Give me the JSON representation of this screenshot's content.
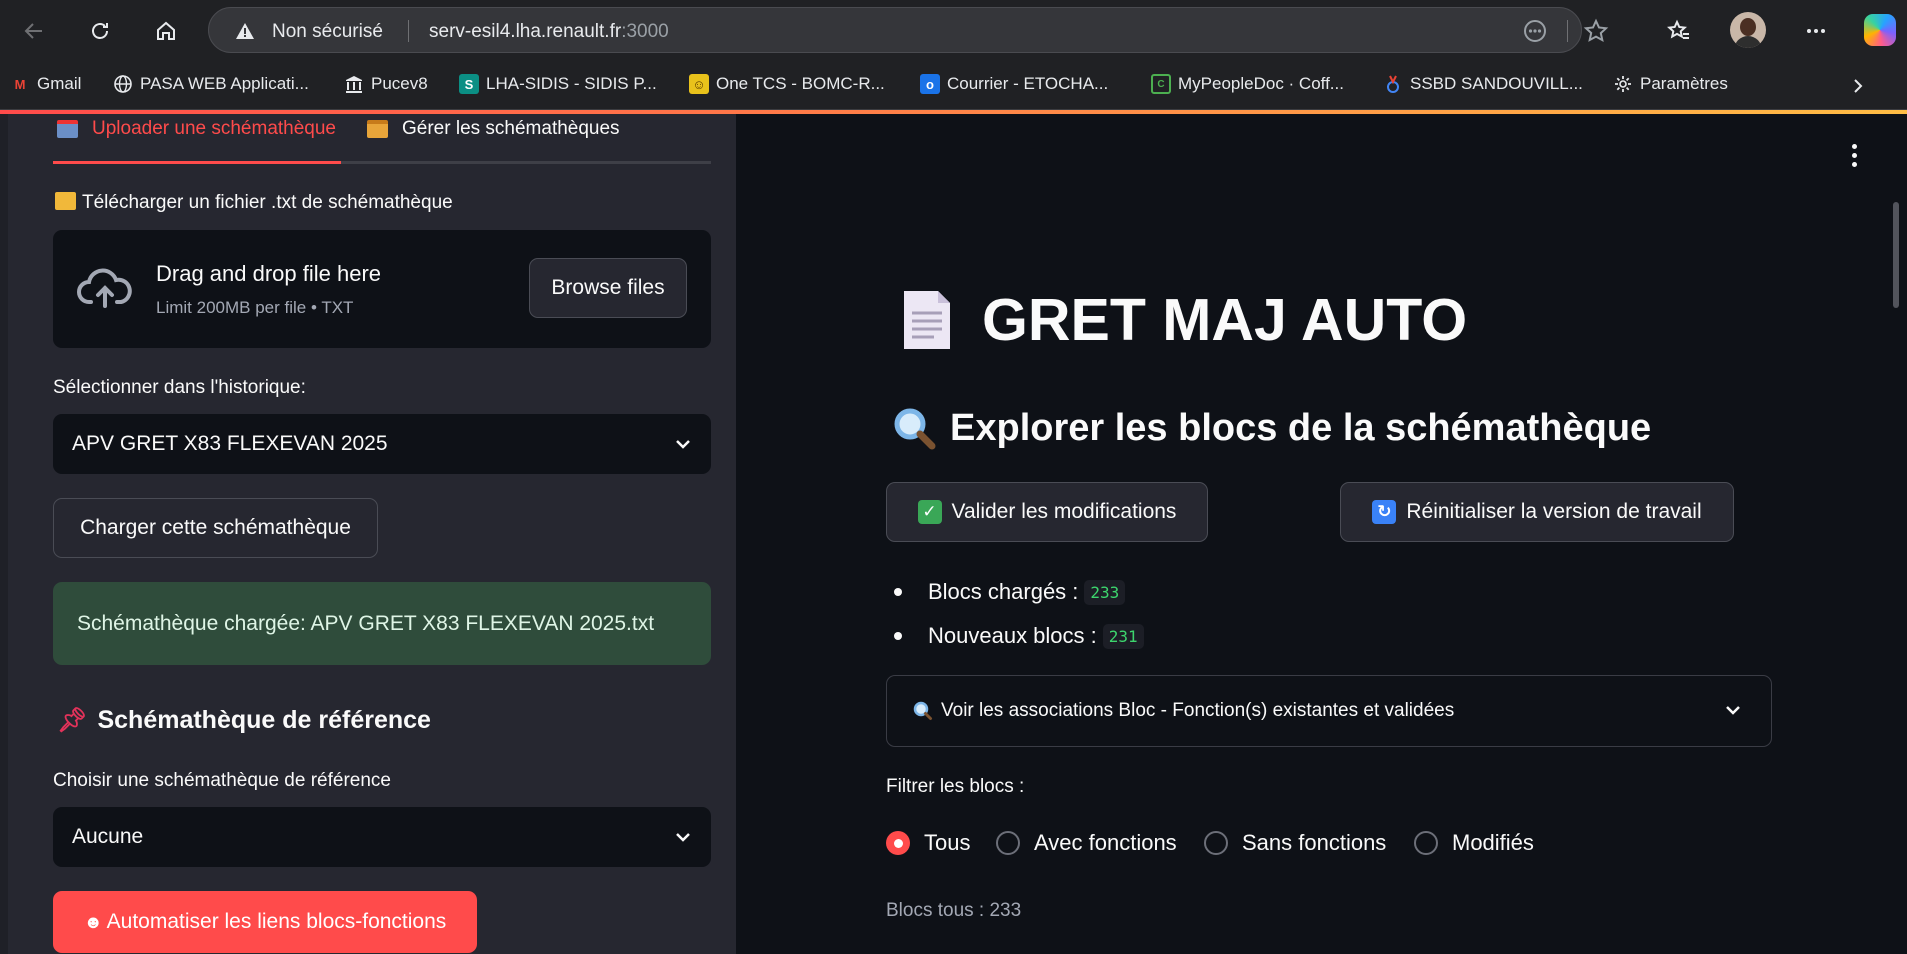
{
  "browser": {
    "security_label": "Non sécurisé",
    "url_host": "serv-esil4.lha.renault.fr",
    "url_port": ":3000",
    "bookmarks": [
      {
        "label": "Gmail",
        "icon": "gmail-icon",
        "color": "#ea4335"
      },
      {
        "label": "PASA WEB Applicati...",
        "icon": "globe-icon",
        "color": "#e8eaed"
      },
      {
        "label": "Pucev8",
        "icon": "building-icon",
        "color": "#e8eaed"
      },
      {
        "label": "LHA-SIDIS - SIDIS P...",
        "icon": "sidis-icon",
        "color": "#0b8f84"
      },
      {
        "label": "One TCS - BOMC-R...",
        "icon": "tcs-icon",
        "color": "#e9c21b"
      },
      {
        "label": "Courrier - ETOCHA...",
        "icon": "outlook-icon",
        "color": "#1a73e8"
      },
      {
        "label": "MyPeopleDoc · Coff...",
        "icon": "mypeopledoc-icon",
        "color": "#4caf50"
      },
      {
        "label": "SSBD SANDOUVILL...",
        "icon": "ssbd-icon",
        "color": "#4285f4"
      },
      {
        "label": "Paramètres",
        "icon": "gear-icon",
        "color": "#e8eaed"
      }
    ]
  },
  "sidebar": {
    "tabs": [
      {
        "label": "Uploader une schémathèque",
        "icon": "inbox-tray-icon"
      },
      {
        "label": "Gérer les schémathèques",
        "icon": "card-file-box-icon"
      }
    ],
    "upload_label": "Télécharger un fichier .txt de schémathèque",
    "dropzone_title": "Drag and drop file here",
    "dropzone_limit": "Limit 200MB per file • TXT",
    "browse_label": "Browse files",
    "history_label": "Sélectionner dans l'historique:",
    "history_value": "APV GRET X83 FLEXEVAN 2025",
    "load_button": "Charger cette schémathèque",
    "success_message": "Schémathèque chargée: APV GRET X83 FLEXEVAN 2025.txt",
    "reference_heading": "Schémathèque de référence",
    "reference_label": "Choisir une schémathèque de référence",
    "reference_value": "Aucune",
    "automate_button": "Automatiser les liens blocs-fonctions",
    "colors": {
      "accent": "#ff4b4b",
      "success_bg": "#2f4c3b"
    }
  },
  "main": {
    "title": "GRET MAJ AUTO",
    "subtitle": "Explorer les blocs de la schémathèque",
    "validate_button": "Valider les modifications",
    "reset_button": "Réinitialiser la version de travail",
    "stats": [
      {
        "label": "Blocs chargés :",
        "value": "233"
      },
      {
        "label": "Nouveaux blocs :",
        "value": "231"
      }
    ],
    "expander_label": "Voir les associations Bloc - Fonction(s) existantes et validées",
    "filter_label": "Filtrer les blocs :",
    "filter_options": [
      "Tous",
      "Avec fonctions",
      "Sans fonctions",
      "Modifiés"
    ],
    "filter_selected": "Tous",
    "count_text": "Blocs tous : 233"
  }
}
